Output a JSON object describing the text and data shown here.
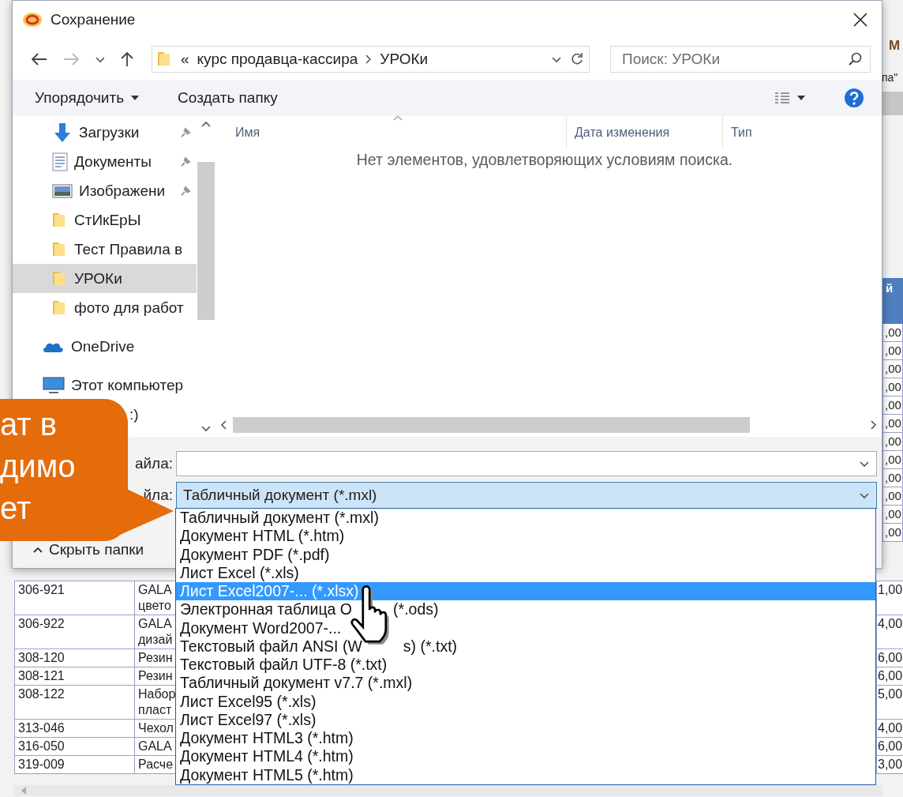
{
  "window": {
    "title": "Сохранение"
  },
  "address": {
    "overflow": "«",
    "crumbs": [
      "курс продавца-кассира",
      "УРОКи"
    ]
  },
  "search": {
    "placeholder": "Поиск: УРОКи"
  },
  "toolbar": {
    "organize": "Упорядочить",
    "new_folder": "Создать папку"
  },
  "nav_items": [
    {
      "kind": "download",
      "label": "Загрузки",
      "pinned": true,
      "selected": false
    },
    {
      "kind": "documents",
      "label": "Документы",
      "pinned": true,
      "selected": false
    },
    {
      "kind": "pictures",
      "label": "Изображени",
      "pinned": true,
      "selected": false
    },
    {
      "kind": "folder",
      "label": "СтИкЕрЫ",
      "pinned": false,
      "selected": false
    },
    {
      "kind": "folder",
      "label": "Тест Правила в",
      "pinned": false,
      "selected": false
    },
    {
      "kind": "folder",
      "label": "УРОКи",
      "pinned": false,
      "selected": true
    },
    {
      "kind": "folder",
      "label": "фото для работ",
      "pinned": false,
      "selected": false
    },
    {
      "kind": "onedrive",
      "label": "OneDrive",
      "pinned": false,
      "selected": false
    },
    {
      "kind": "computer",
      "label": "Этот компьютер",
      "pinned": false,
      "selected": false
    },
    {
      "kind": "drive",
      "label": ":)",
      "pinned": false,
      "selected": false
    }
  ],
  "columns": [
    "Имя",
    "Дата изменения",
    "Тип"
  ],
  "empty_message": "Нет элементов, удовлетворяющих условиям поиска.",
  "file_name": {
    "label": "айла:"
  },
  "file_type": {
    "label": "йла:",
    "value": "Табличный документ (*.mxl)"
  },
  "hide_folders": "Скрыть папки",
  "type_options": [
    {
      "parts": [
        "Табличный документ (*.mxl)"
      ],
      "selected": false
    },
    {
      "parts": [
        "Документ HTML (*.htm)"
      ],
      "selected": false
    },
    {
      "parts": [
        "Документ PDF (*.pdf)"
      ],
      "selected": false
    },
    {
      "parts": [
        "Лист Excel (*.xls)"
      ],
      "selected": false
    },
    {
      "parts": [
        "Лист Excel2007-... (*.xlsx)"
      ],
      "selected": true
    },
    {
      "parts": [
        "Электронная таблица O",
        "(*.ods)"
      ],
      "selected": false
    },
    {
      "parts": [
        "Документ Word2007-..."
      ],
      "selected": false
    },
    {
      "parts": [
        "Текстовый файл ANSI (W",
        "s) (*.txt)"
      ],
      "selected": false
    },
    {
      "parts": [
        "Текстовый файл UTF-8 (*.txt)"
      ],
      "selected": false
    },
    {
      "parts": [
        "Табличный документ v7.7 (*.mxl)"
      ],
      "selected": false
    },
    {
      "parts": [
        "Лист Excel95 (*.xls)"
      ],
      "selected": false
    },
    {
      "parts": [
        "Лист Excel97 (*.xls)"
      ],
      "selected": false
    },
    {
      "parts": [
        "Документ HTML3 (*.htm)"
      ],
      "selected": false
    },
    {
      "parts": [
        "Документ HTML4 (*.htm)"
      ],
      "selected": false
    },
    {
      "parts": [
        "Документ HTML5 (*.htm)"
      ],
      "selected": false
    }
  ],
  "callout": {
    "lines": [
      "ат в",
      "димо",
      "ет"
    ]
  },
  "background": {
    "heading": "М",
    "subheading": "па\"",
    "column_header": "й",
    "column_values": [
      ",00",
      ",00",
      ",00",
      ",00",
      ",00",
      ",00",
      ",00",
      ",00",
      ",00",
      ",00",
      ",00",
      ",00"
    ],
    "rows": [
      {
        "code": "306-921",
        "name_lines": [
          "GALA",
          "цвето"
        ],
        "value": "1,00"
      },
      {
        "code": "306-922",
        "name_lines": [
          "GALA",
          "дизай"
        ],
        "value": "4,00"
      },
      {
        "code": "308-120",
        "name_lines": [
          "Резин"
        ],
        "value": "6,00"
      },
      {
        "code": "308-121",
        "name_lines": [
          "Резин"
        ],
        "value": "6,00"
      },
      {
        "code": "308-122",
        "name_lines": [
          "Набор",
          "пласт"
        ],
        "value": "5,00"
      },
      {
        "code": "313-046",
        "name_lines": [
          "Чехол"
        ],
        "value": "4,00"
      },
      {
        "code": "316-050",
        "name_lines": [
          "GALA"
        ],
        "value": "6,00"
      },
      {
        "code": "319-009",
        "name_lines": [
          "Расче"
        ],
        "value": "3,00"
      }
    ]
  }
}
